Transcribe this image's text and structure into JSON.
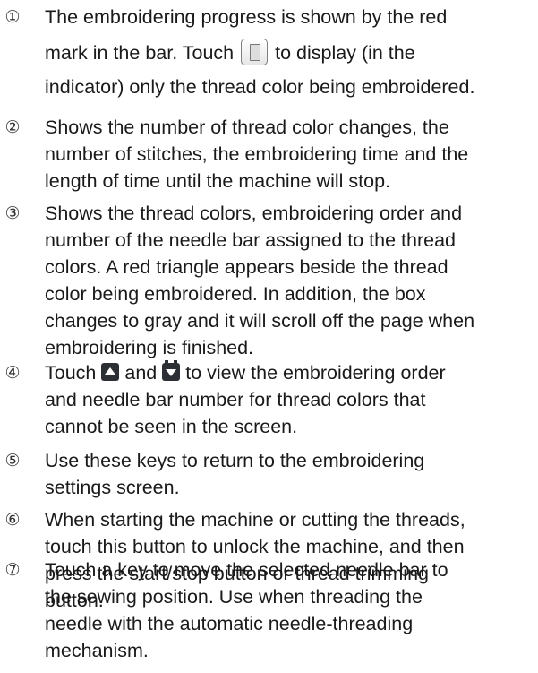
{
  "items": [
    {
      "marker": "①",
      "lines": [
        "The embroidering progress is shown by the red",
        "mark in the bar. Touch",
        "to display (in the",
        "indicator) only the thread color being embroidered."
      ],
      "icon": "thread-color-display-icon"
    },
    {
      "marker": "②",
      "lines": [
        "Shows the number of thread color changes, the",
        "number of stitches, the embroidering time and the",
        "length of time until the machine will stop."
      ]
    },
    {
      "marker": "③",
      "lines": [
        "Shows the thread colors, embroidering order and",
        "number of the needle bar assigned to the thread",
        "colors. A red triangle appears beside the thread",
        "color being embroidered. In addition, the box",
        "changes to gray and it will scroll off the page when",
        "embroidering is finished."
      ]
    },
    {
      "marker": "④",
      "lines": [
        "Touch",
        "and",
        "to view the embroidering order",
        "and needle bar number for thread colors that",
        "cannot be seen in the screen."
      ],
      "icons": [
        "scroll-up-icon",
        "scroll-down-icon"
      ]
    },
    {
      "marker": "⑤",
      "lines": [
        "Use these keys to return to the embroidering",
        "settings screen."
      ]
    },
    {
      "marker": "⑥",
      "lines": [
        "When starting the machine or cutting the threads,",
        "touch this button to unlock the machine, and then",
        "press the start/stop button or thread trimming",
        "button."
      ]
    },
    {
      "marker": "⑦",
      "lines": [
        "Touch a key to move the selected needle bar to",
        "the sewing position. Use when threading the",
        "needle with the automatic needle-threading",
        "mechanism."
      ]
    }
  ]
}
